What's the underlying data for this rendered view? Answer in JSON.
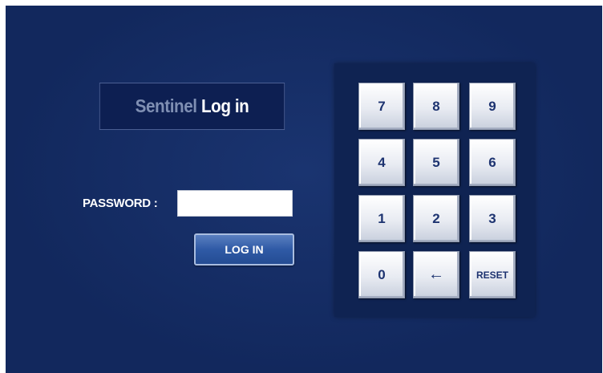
{
  "title": {
    "brand": "Sentinel",
    "action": "Log in"
  },
  "login_form": {
    "password_label": "PASSWORD :",
    "password_value": "",
    "login_button": "LOG IN"
  },
  "keypad": {
    "keys": [
      "7",
      "8",
      "9",
      "4",
      "5",
      "6",
      "1",
      "2",
      "3",
      "0",
      "←",
      "RESET"
    ]
  },
  "colors": {
    "background": "#12285d",
    "key_text": "#1d3370",
    "login_button": "#2f5aa6"
  }
}
